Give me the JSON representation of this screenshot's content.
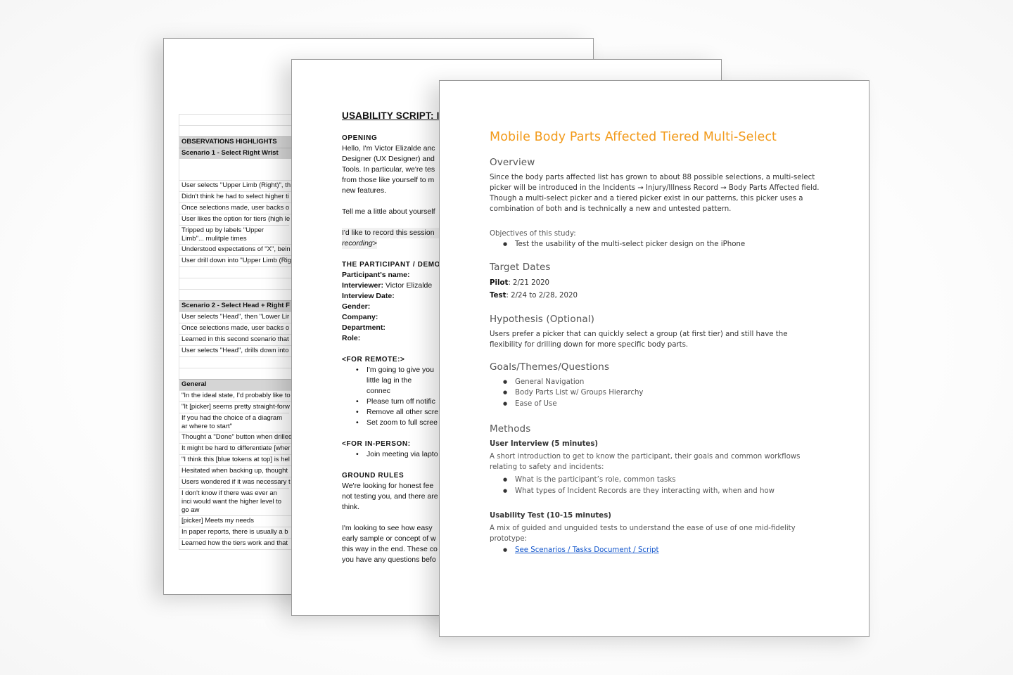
{
  "page1": {
    "section_header": "OBSERVATIONS HIGHLIGHTS",
    "scenario1": {
      "title": "Scenario 1 - Select Right Wrist",
      "rows": [
        "User selects \"Upper Limb (Right)\", th",
        "Didn't think he had to select higher ti",
        "Once selections made, user backs o",
        "User likes the option for tiers (high le",
        "Tripped up by labels \"Upper Limb\"... mulitple times",
        "Understood expectations of \"X\", bein",
        "User drill down into \"Upper Limb (Rig"
      ]
    },
    "scenario2": {
      "title": "Scenario 2 - Select Head + Right F",
      "rows": [
        "User selects \"Head\", then \"Lower Lir",
        "Once selections made, user backs o",
        "Learned in this second scenario that",
        "User selects \"Head\", drills down into"
      ]
    },
    "general": {
      "title": "General",
      "rows": [
        "\"In the ideal state, I'd probably like to",
        "\"It [picker] seems pretty straight-forw",
        "If you had the choice of a diagram ar where to start\"",
        "Thought a \"Done\" button when drilled",
        "It might be hard to differentiate [wher",
        "\"I think this [blue tokens at top] is hel",
        "Hesitated when backing up, thought",
        "Users wondered if it was necessary t",
        "I don't know if there was ever an inci would want the higher level to go aw",
        "[picker] Meets my needs",
        "In paper reports, there is usually a b",
        "Learned how the tiers work and that"
      ]
    }
  },
  "page2": {
    "title": "USABILITY SCRIPT: I",
    "opening": {
      "heading": "OPENING",
      "lines": [
        "Hello, I'm Victor Elizalde anc",
        "Designer (UX Designer) and",
        "Tools. In particular, we're tes",
        "from those like yourself to m",
        "new features."
      ],
      "tell_me": "Tell me a little about yourself",
      "record_1": "I'd like to record this session",
      "record_2": "recording>"
    },
    "participant": {
      "heading": "THE PARTICIPANT / DEMO",
      "fields": [
        {
          "label": "Participant's name:",
          "value": ""
        },
        {
          "label": "Interviewer:",
          "value": "Victor Elizalde"
        },
        {
          "label": "Interview Date:",
          "value": ""
        },
        {
          "label": "Gender:",
          "value": ""
        },
        {
          "label": "Company:",
          "value": ""
        },
        {
          "label": "Department:",
          "value": ""
        },
        {
          "label": "Role:",
          "value": ""
        }
      ]
    },
    "remote": {
      "heading": "<FOR REMOTE:>",
      "items": [
        "I'm going to give you little lag in the connec",
        "Please turn off notific",
        "Remove all other scre",
        "Set zoom to full scree"
      ]
    },
    "in_person": {
      "heading": "<FOR IN-PERSON:",
      "items": [
        "Join meeting via lapto"
      ]
    },
    "ground_rules": {
      "heading": "GROUND RULES",
      "para1": [
        "We're looking for honest fee",
        "not testing you, and there are",
        "think."
      ],
      "para2": [
        "I'm looking to see how easy",
        "early sample or concept of w",
        "this way in the end. These co",
        "you have any questions befo"
      ]
    }
  },
  "page3": {
    "title": "Mobile Body Parts Affected Tiered Multi-Select",
    "overview": {
      "heading": "Overview",
      "text": "Since the body parts affected list has grown to about 88 possible selections, a multi-select picker will be introduced in the Incidents → Injury/Illness Record → Body Parts Affected field. Though a multi-select picker and a tiered picker exist in our patterns, this picker uses a combination of both and is technically a new and untested pattern."
    },
    "objectives": {
      "label": "Objectives of this study:",
      "items": [
        "Test the usability of the multi-select picker design on the iPhone"
      ]
    },
    "target_dates": {
      "heading": "Target Dates",
      "pilot_label": "Pilot",
      "pilot_value": ": 2/21 2020",
      "test_label": "Test",
      "test_value": ": 2/24 to 2/28, 2020"
    },
    "hypothesis": {
      "heading": "Hypothesis (Optional)",
      "text": "Users prefer a picker that can quickly select a group (at first tier) and still have the flexibility for drilling down for more specific body parts."
    },
    "goals": {
      "heading": "Goals/Themes/Questions",
      "items": [
        "General Navigation",
        "Body Parts List w/ Groups Hierarchy",
        "Ease of Use"
      ]
    },
    "methods": {
      "heading": "Methods",
      "interview": {
        "title": "User Interview (5 minutes)",
        "text": "A short introduction to get to know the participant, their goals and common workflows relating to safety and incidents:",
        "items": [
          "What is the participant’s role, common tasks",
          "What types of Incident Records are they interacting with, when and how"
        ]
      },
      "usability": {
        "title": "Usability Test (10-15 minutes)",
        "text": "A mix of guided and unguided tests to understand the ease of use of one mid-fidelity prototype:",
        "link": "See Scenarios / Tasks Document / Script"
      }
    }
  },
  "colors": {
    "title_orange": "#f29a1a",
    "link_blue": "#1155cc",
    "sheet_header_gray": "#d5d5d5"
  }
}
